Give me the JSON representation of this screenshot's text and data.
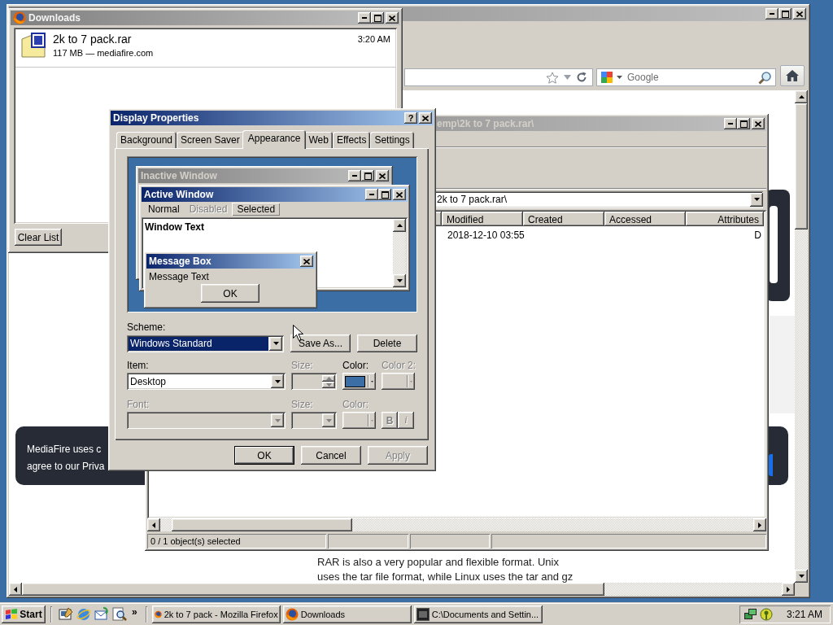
{
  "firefox_window": {
    "search": {
      "placeholder": "Google"
    },
    "page": {
      "cookie_banner": {
        "lines": [
          "MediaFire uses c",
          "agree to our Priva"
        ]
      },
      "article": {
        "lines": [
          "RAR is also a very popular and flexible format. Unix",
          "uses the tar file format, while Linux uses the tar and gz"
        ]
      }
    }
  },
  "sevenzip_window": {
    "title": "emp\\2k to 7 pack.rar\\",
    "address": "2k to 7 pack.rar\\",
    "columns": [
      "Modified",
      "Created",
      "Accessed",
      "Attributes"
    ],
    "rows": [
      {
        "modified": "2018-12-10 03:55",
        "attributes": "D"
      }
    ],
    "status_bar": "0 / 1 object(s) selected"
  },
  "downloads_window": {
    "title": "Downloads",
    "items": [
      {
        "name": "2k to 7 pack.rar",
        "details": "117 MB — mediafire.com",
        "time": "3:20 AM"
      }
    ],
    "clear_button": "Clear List"
  },
  "display_properties": {
    "title": "Display Properties",
    "help_button": "?",
    "tabs": [
      {
        "label": "Background",
        "selected": false
      },
      {
        "label": "Screen Saver",
        "selected": false
      },
      {
        "label": "Appearance",
        "selected": true
      },
      {
        "label": "Web",
        "selected": false
      },
      {
        "label": "Effects",
        "selected": false
      },
      {
        "label": "Settings",
        "selected": false
      }
    ],
    "preview": {
      "inactive_title": "Inactive Window",
      "active_title": "Active Window",
      "menu": [
        {
          "label": "Normal",
          "kind": "normal"
        },
        {
          "label": "Disabled",
          "kind": "disabled"
        },
        {
          "label": "Selected",
          "kind": "selected"
        }
      ],
      "window_text": "Window Text",
      "message_box": {
        "title": "Message Box",
        "text": "Message Text",
        "button": "OK"
      }
    },
    "scheme": {
      "label": "Scheme:",
      "value": "Windows Standard",
      "focused": true,
      "buttons": [
        {
          "label": "Save As...",
          "disabled": false
        },
        {
          "label": "Delete",
          "disabled": false
        }
      ]
    },
    "item_row": [
      {
        "kind": "combo",
        "label": "Item:",
        "value": "Desktop",
        "disabled": false
      },
      {
        "kind": "spinner",
        "label": "Size:",
        "disabled": true
      },
      {
        "kind": "color",
        "label": "Color:",
        "color": "#3a6ea5",
        "disabled": false
      },
      {
        "kind": "color",
        "label": "Color 2:",
        "disabled": true
      }
    ],
    "font_row": [
      {
        "kind": "combo",
        "label": "Font:",
        "disabled": true
      },
      {
        "kind": "combo",
        "label": "Size:",
        "disabled": true
      },
      {
        "kind": "color",
        "label": "Color:",
        "disabled": true
      },
      {
        "kind": "style_buttons",
        "disabled": true,
        "buttons": [
          {
            "label": "B",
            "kind": "bold"
          },
          {
            "label": "i",
            "kind": "italic"
          }
        ]
      }
    ],
    "buttons": [
      {
        "label": "OK",
        "default": true,
        "disabled": false
      },
      {
        "label": "Cancel",
        "default": false,
        "disabled": false
      },
      {
        "label": "Apply",
        "default": false,
        "disabled": true
      }
    ]
  },
  "taskbar": {
    "start": "Start",
    "chevron": "»",
    "tasks": [
      {
        "label": "2k to 7 pack - Mozilla Firefox",
        "kind": "firefox",
        "selected": false
      },
      {
        "label": "Downloads",
        "kind": "firefox",
        "selected": false
      },
      {
        "label": "C:\\Documents and Settin...",
        "kind": "sevenzip",
        "selected": false
      }
    ],
    "clock": "3:21 AM"
  }
}
